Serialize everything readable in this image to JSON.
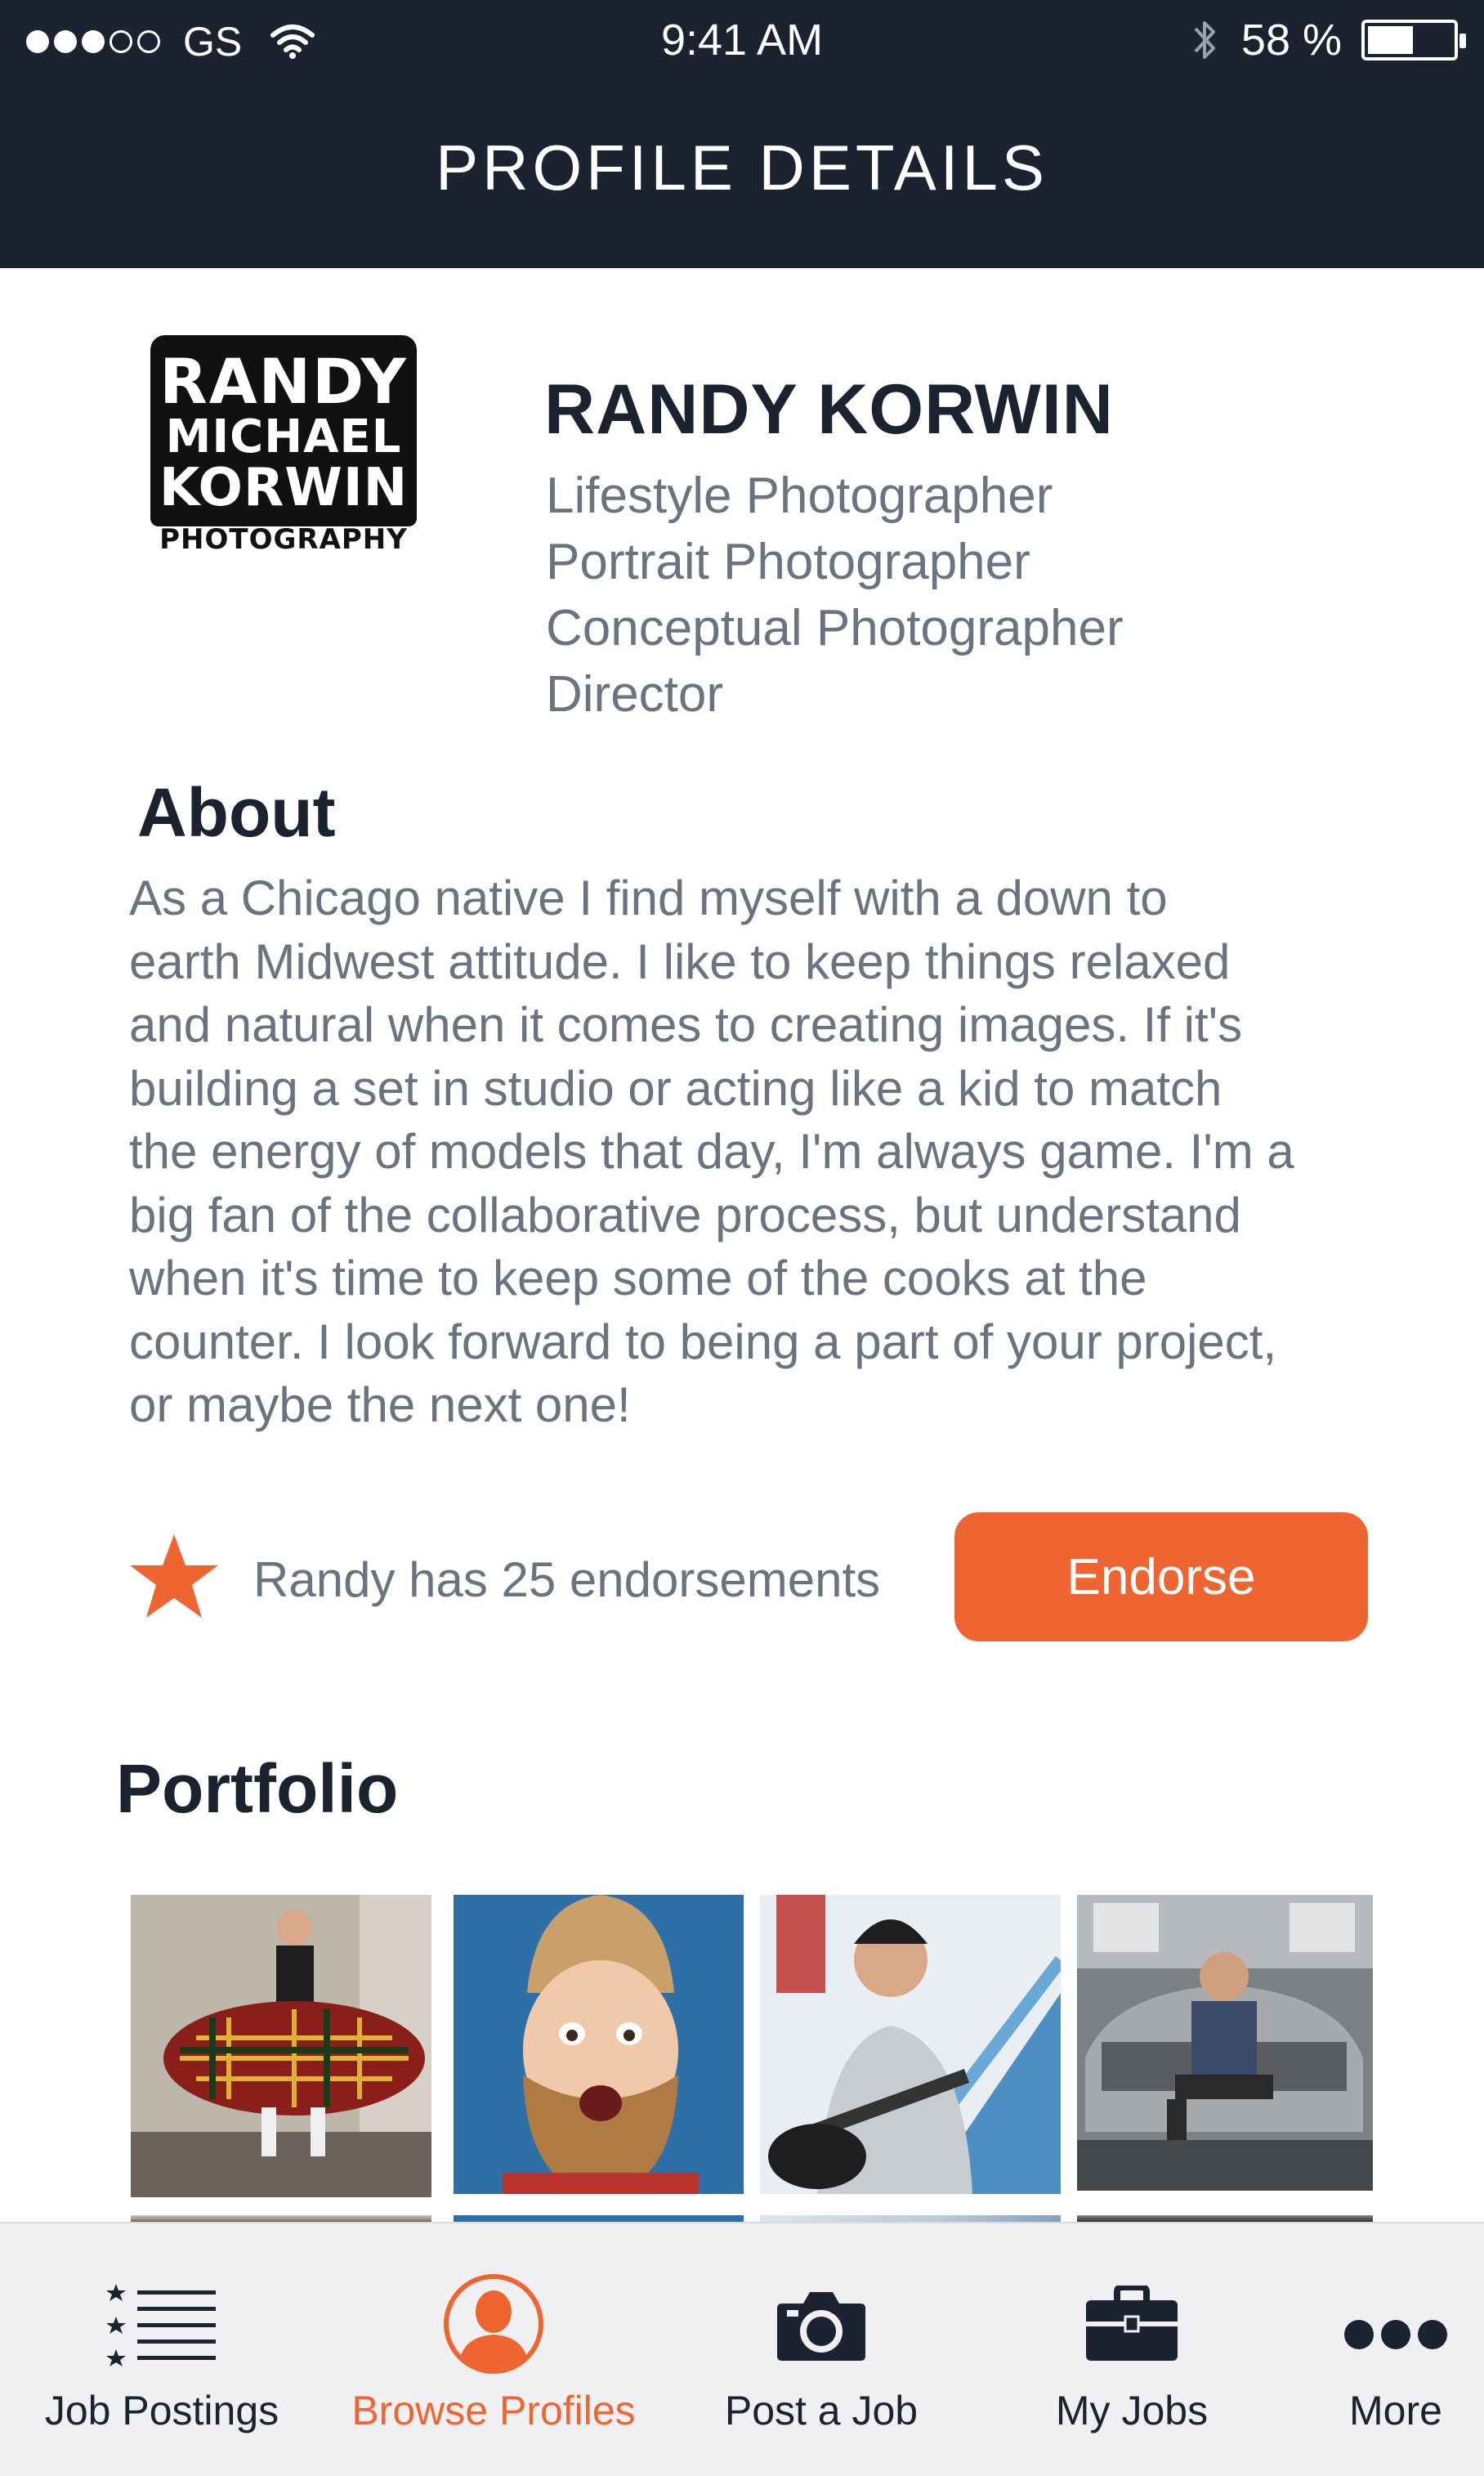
{
  "status_bar": {
    "carrier": "GS",
    "time": "9:41 AM",
    "battery_text": "58 %",
    "battery_level": 0.58,
    "signal_bars_filled": 3,
    "signal_bars_total": 5
  },
  "header": {
    "title": "PROFILE DETAILS"
  },
  "profile": {
    "logo_lines": [
      "RANDY",
      "MICHAEL",
      "KORWIN",
      "PHOTOGRAPHY"
    ],
    "name": "RANDY KORWIN",
    "roles": [
      "Lifestyle Photographer",
      "Portrait Photographer",
      "Conceptual Photographer",
      "Director"
    ]
  },
  "about": {
    "heading": "About",
    "lines": [
      "As a Chicago native I find myself with a down to",
      "earth Midwest attitude. I like to keep things relaxed",
      "and natural when it comes to creating images. If it's",
      "building a set in studio or acting like a kid to match",
      "the energy of models that day, I'm always game. I'm a",
      "big fan of the collaborative process, but understand",
      "when it's time to keep some of the cooks at the",
      "counter. I look forward to being a part of your project,",
      "or maybe the next one!"
    ]
  },
  "endorsements": {
    "text": "Randy has 25 endorsements",
    "count": 25,
    "button_label": "Endorse"
  },
  "portfolio": {
    "heading": "Portfolio"
  },
  "tabbar": {
    "items": [
      {
        "label": "Job Postings",
        "icon": "list-icon",
        "active": false
      },
      {
        "label": "Browse Profiles",
        "icon": "person-icon",
        "active": true
      },
      {
        "label": "Post a Job",
        "icon": "camera-icon",
        "active": false
      },
      {
        "label": "My Jobs",
        "icon": "briefcase-icon",
        "active": false
      },
      {
        "label": "More",
        "icon": "more-icon",
        "active": false
      }
    ]
  },
  "colors": {
    "header_bg": "#1b2230",
    "accent": "#ef6532",
    "secondary_text": "#6b7280",
    "tabbar_bg": "#f0f0f2"
  }
}
